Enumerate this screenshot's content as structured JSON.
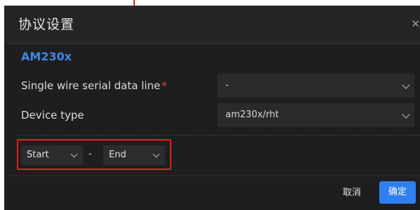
{
  "dialog": {
    "title": "协议设置",
    "close_icon": "close-icon",
    "section_title": "AM230x",
    "fields": [
      {
        "label": "Single wire serial data line",
        "required_mark": "*",
        "value": "-"
      },
      {
        "label": "Device type",
        "value": "am230x/rht"
      }
    ],
    "range": {
      "start": "Start",
      "separator": "-",
      "end": "End"
    },
    "buttons": {
      "cancel": "取消",
      "ok": "确定"
    }
  },
  "colors": {
    "dialog_bg": "#1e1e1e",
    "accent": "#3d87e8",
    "primary_button": "#2f7ff0",
    "required": "#e04a4a",
    "highlight_box": "#e02020"
  }
}
